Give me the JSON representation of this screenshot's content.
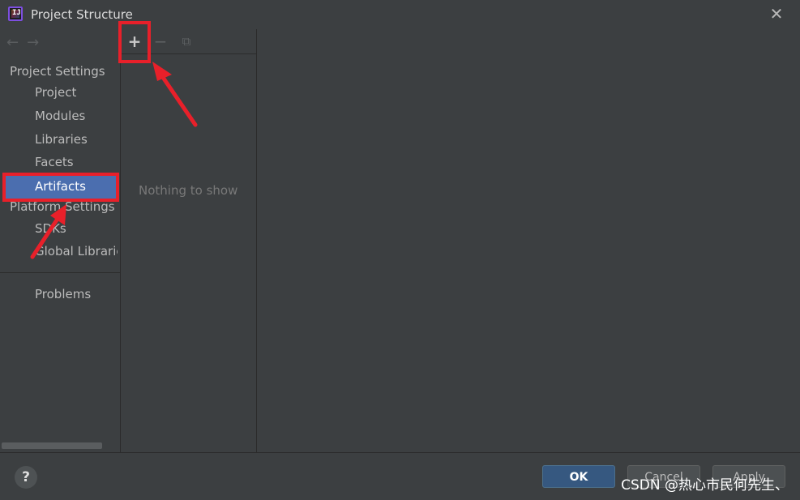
{
  "window": {
    "title": "Project Structure",
    "app_icon_text": "IJ"
  },
  "sidebar": {
    "project_settings_header": "Project Settings",
    "project_items": [
      {
        "label": "Project"
      },
      {
        "label": "Modules"
      },
      {
        "label": "Libraries"
      },
      {
        "label": "Facets"
      },
      {
        "label": "Artifacts",
        "selected": true
      }
    ],
    "platform_settings_header": "Platform Settings",
    "platform_items": [
      {
        "label": "SDKs"
      },
      {
        "label": "Global Libraries"
      }
    ],
    "problems_label": "Problems"
  },
  "toolbar": {
    "add_icon": "+",
    "remove_icon": "−",
    "copy_icon": "⧉"
  },
  "middle": {
    "empty_text": "Nothing to show"
  },
  "footer": {
    "help_label": "?",
    "ok_label": "OK",
    "cancel_label": "Cancel",
    "apply_label": "Apply",
    "watermark": "CSDN @热心市民何先生、"
  },
  "colors": {
    "selection": "#4b6eaf",
    "highlight": "#e8202a",
    "background": "#3c3f41"
  }
}
